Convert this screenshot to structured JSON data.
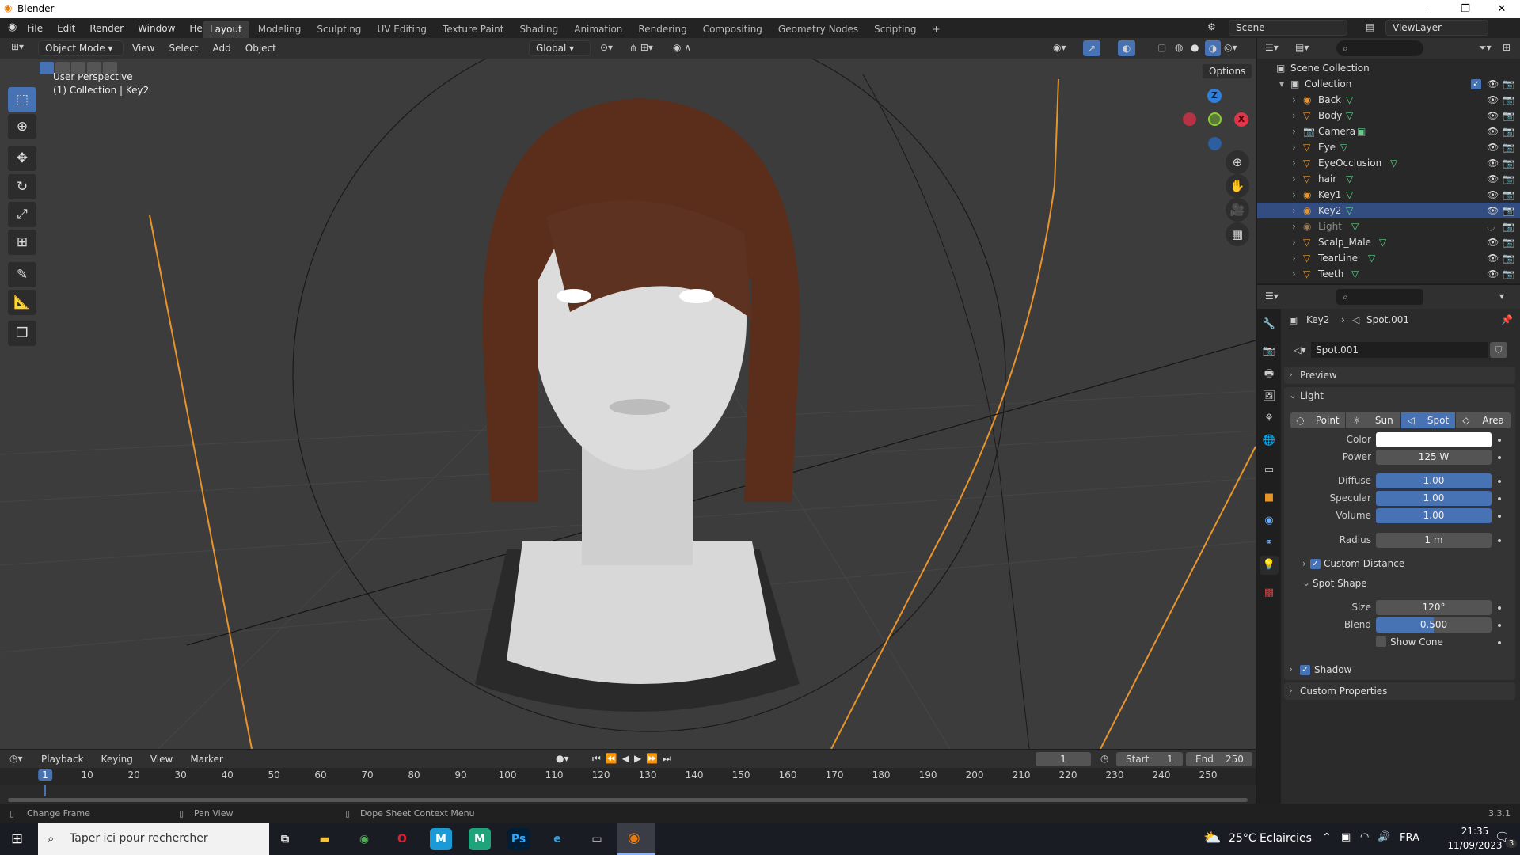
{
  "window": {
    "title": "Blender",
    "minimize": "–",
    "maximize": "❐",
    "close": "✕"
  },
  "menu": [
    "File",
    "Edit",
    "Render",
    "Window",
    "Help"
  ],
  "workspaces": [
    "Layout",
    "Modeling",
    "Sculpting",
    "UV Editing",
    "Texture Paint",
    "Shading",
    "Animation",
    "Rendering",
    "Compositing",
    "Geometry Nodes",
    "Scripting",
    "+"
  ],
  "scene": {
    "name": "Scene",
    "view_layer": "ViewLayer"
  },
  "viewport_header": {
    "mode": "Object Mode",
    "menus": [
      "View",
      "Select",
      "Add",
      "Object"
    ],
    "orientation": "Global",
    "options": "Options"
  },
  "viewport": {
    "perspective": "User Perspective",
    "collection_info": "(1) Collection | Key2",
    "gizmo": {
      "z": "Z",
      "x": "X"
    }
  },
  "outliner": {
    "root": "Scene Collection",
    "collection": "Collection",
    "items": [
      {
        "name": "Back",
        "selected": false,
        "dim": false
      },
      {
        "name": "Body",
        "selected": false,
        "dim": false
      },
      {
        "name": "Camera",
        "selected": false,
        "dim": false
      },
      {
        "name": "Eye",
        "selected": false,
        "dim": false
      },
      {
        "name": "EyeOcclusion",
        "selected": false,
        "dim": false
      },
      {
        "name": "hair",
        "selected": false,
        "dim": false
      },
      {
        "name": "Key1",
        "selected": false,
        "dim": false
      },
      {
        "name": "Key2",
        "selected": true,
        "dim": false
      },
      {
        "name": "Light",
        "selected": false,
        "dim": true
      },
      {
        "name": "Scalp_Male",
        "selected": false,
        "dim": false
      },
      {
        "name": "TearLine",
        "selected": false,
        "dim": false
      },
      {
        "name": "Teeth",
        "selected": false,
        "dim": false
      }
    ]
  },
  "properties": {
    "breadcrumb_object": "Key2",
    "breadcrumb_data": "Spot.001",
    "datablock": "Spot.001",
    "preview": "Preview",
    "light": "Light",
    "light_types": [
      "Point",
      "Sun",
      "Spot",
      "Area"
    ],
    "active_type": "Spot",
    "color_label": "Color",
    "color": "#ffffff",
    "power_label": "Power",
    "power": "125 W",
    "diffuse_label": "Diffuse",
    "diffuse": "1.00",
    "specular_label": "Specular",
    "specular": "1.00",
    "volume_label": "Volume",
    "volume": "1.00",
    "radius_label": "Radius",
    "radius": "1 m",
    "custom_distance": "Custom Distance",
    "spot_shape": "Spot Shape",
    "size_label": "Size",
    "size": "120°",
    "blend_label": "Blend",
    "blend": "0.500",
    "blend_fraction": 0.5,
    "show_cone": "Show Cone",
    "shadow": "Shadow",
    "custom_properties": "Custom Properties"
  },
  "timeline": {
    "menus": [
      "Playback",
      "Keying",
      "View",
      "Marker"
    ],
    "current_frame": "1",
    "start_label": "Start",
    "start": "1",
    "end_label": "End",
    "end": "250",
    "ticks": [
      1,
      10,
      20,
      30,
      40,
      50,
      60,
      70,
      80,
      90,
      100,
      110,
      120,
      130,
      140,
      150,
      160,
      170,
      180,
      190,
      200,
      210,
      220,
      230,
      240,
      250
    ]
  },
  "status": {
    "change_frame": "Change Frame",
    "pan_view": "Pan View",
    "context_menu": "Dope Sheet Context Menu",
    "version": "3.3.1"
  },
  "taskbar": {
    "search_placeholder": "Taper ici pour rechercher",
    "weather": "25°C  Eclaircies",
    "lang": "FRA",
    "time": "21:35",
    "date": "11/09/2023",
    "notifications": "3"
  }
}
